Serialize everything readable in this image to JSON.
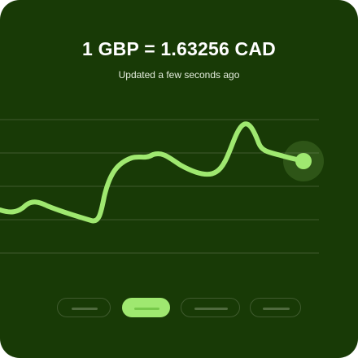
{
  "widget": {
    "rate_text": "1 GBP = 1.63256 CAD",
    "updated_text": "Updated a few seconds ago"
  },
  "range_selector": {
    "selected_index": 1,
    "option_count": 4
  },
  "colors": {
    "card_background": "#183a06",
    "line": "#9fe870",
    "gridline": "#3f5a2e",
    "active_range": "#9fe870"
  }
}
